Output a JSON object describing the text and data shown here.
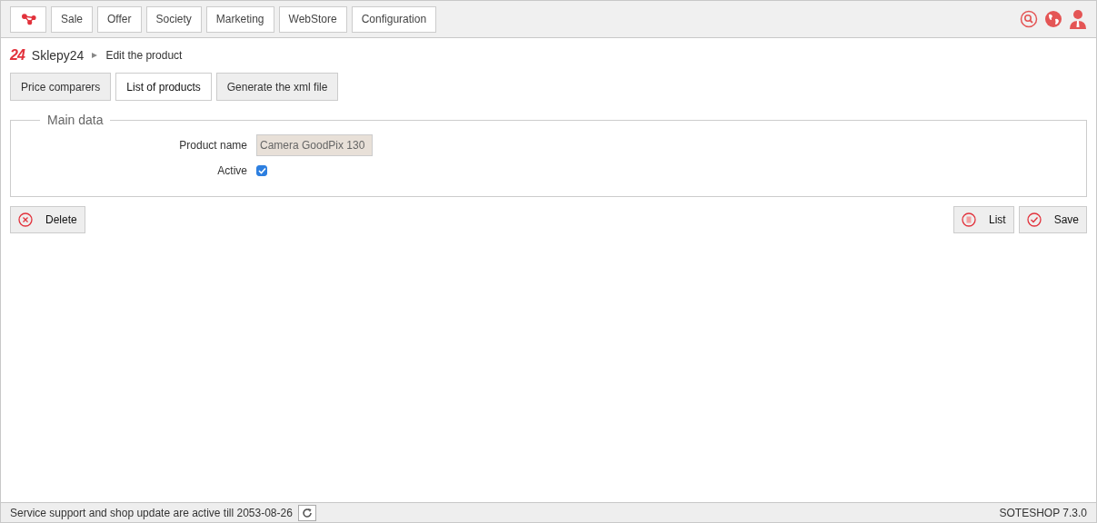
{
  "menu": [
    "Sale",
    "Offer",
    "Society",
    "Marketing",
    "WebStore",
    "Configuration"
  ],
  "breadcrumb": {
    "logo": "24",
    "shop": "Sklepy24",
    "page": "Edit the product"
  },
  "tabs": [
    {
      "label": "Price comparers",
      "selected": false
    },
    {
      "label": "List of products",
      "selected": true
    },
    {
      "label": "Generate the xml file",
      "selected": false
    }
  ],
  "fieldset": {
    "legend": "Main data",
    "product_name_label": "Product name",
    "product_name_value": "Camera GoodPix 130",
    "active_label": "Active",
    "active_checked": true
  },
  "actions": {
    "delete": "Delete",
    "list": "List",
    "save": "Save"
  },
  "footer": {
    "notice": "Service support and shop update are active till 2053-08-26",
    "version": "SOTESHOP 7.3.0"
  }
}
